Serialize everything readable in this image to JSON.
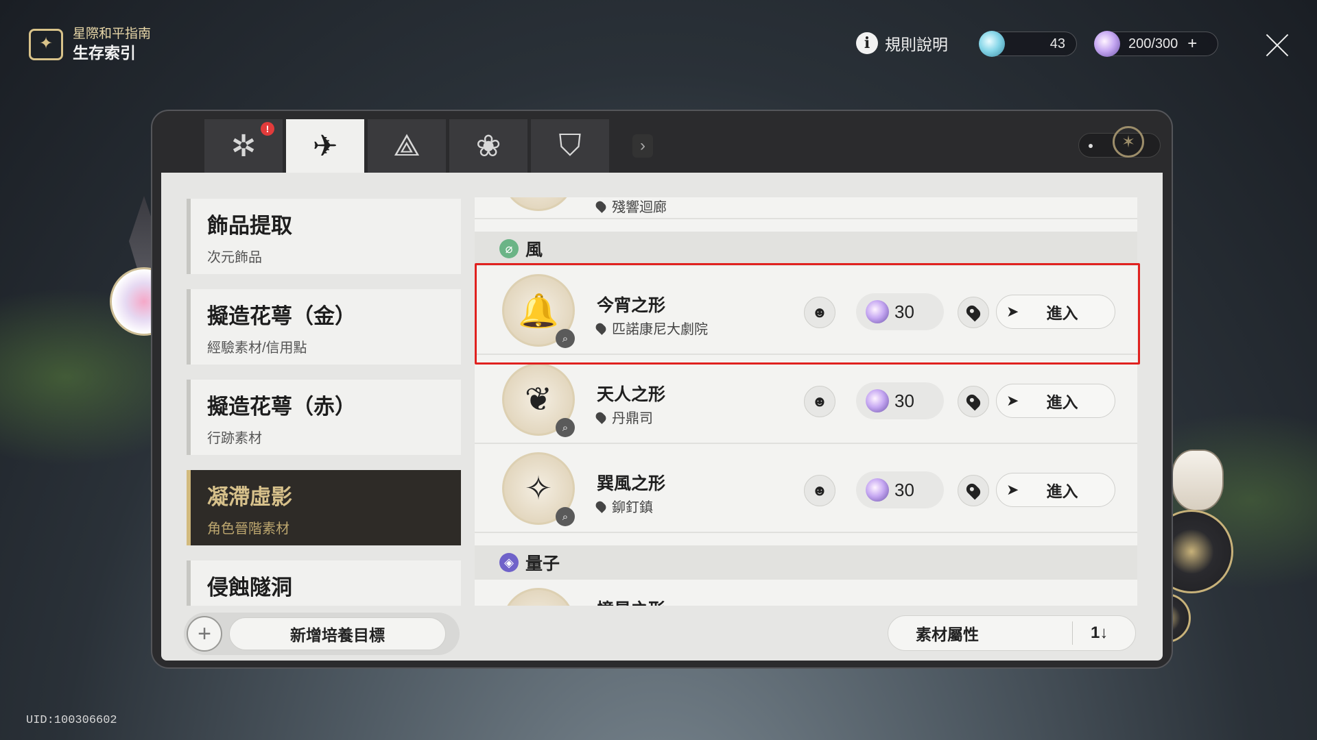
{
  "header": {
    "brand_sub": "星際和平指南",
    "brand_title": "生存索引",
    "rules_label": "規則說明",
    "resource1_value": "43",
    "resource2_value": "200/300",
    "resource2_plus": "+"
  },
  "tabs": [
    {
      "icon": "compass-gear-icon",
      "glyph": "✲",
      "badge": "!",
      "active": false
    },
    {
      "icon": "paper-plane-icon",
      "glyph": "✈",
      "active": true
    },
    {
      "icon": "triangle-emblem-icon",
      "glyph": "⟁",
      "active": false
    },
    {
      "icon": "lotus-emblem-icon",
      "glyph": "❀",
      "active": false
    },
    {
      "icon": "shield-trident-icon",
      "glyph": "⛉",
      "active": false
    }
  ],
  "categories": [
    {
      "title": "飾品提取",
      "sub": "次元飾品"
    },
    {
      "title": "擬造花萼（金）",
      "sub": "經驗素材/信用點"
    },
    {
      "title": "擬造花萼（赤）",
      "sub": "行跡素材"
    },
    {
      "title": "凝滯虛影",
      "sub": "角色晉階素材"
    },
    {
      "title": "侵蝕隧洞",
      "sub": ""
    }
  ],
  "add_goal_label": "新增培養目標",
  "list": {
    "partial_top_location": "殘響迴廊",
    "group_wind": "風",
    "group_quantum": "量子",
    "items": [
      {
        "name": "今宵之形",
        "location": "匹諾康尼大劇院",
        "cost": "30",
        "enter": "進入",
        "glyph": "🔔"
      },
      {
        "name": "天人之形",
        "location": "丹鼎司",
        "cost": "30",
        "enter": "進入",
        "glyph": "❦"
      },
      {
        "name": "巽風之形",
        "location": "鉚釘鎮",
        "cost": "30",
        "enter": "進入",
        "glyph": "✧"
      }
    ],
    "partial_bottom_name": "憶星之形"
  },
  "sort": {
    "label": "素材屬性",
    "icon": "1↓"
  },
  "uid": "UID:100306602",
  "colors": {
    "highlight": "#e0211f",
    "accent_gold": "#d2ba7d",
    "panel_dark": "#2b2b2d"
  }
}
